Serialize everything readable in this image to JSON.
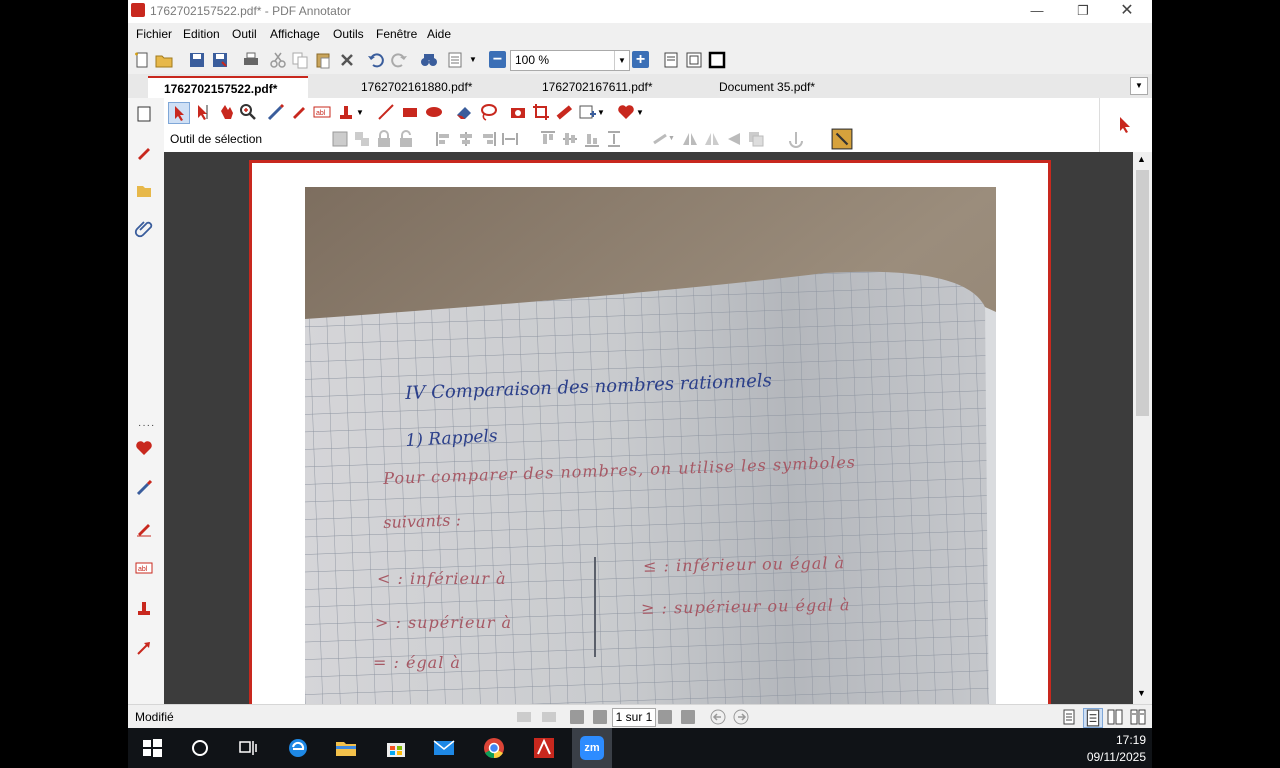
{
  "window": {
    "title": "1762702157522.pdf* - PDF Annotator"
  },
  "menu": [
    "Fichier",
    "Edition",
    "Outil",
    "Affichage",
    "Outils",
    "Fenêtre",
    "Aide"
  ],
  "toolbar": {
    "zoom_value": "100 %"
  },
  "tabs": [
    {
      "label": "1762702157522.pdf*",
      "active": true
    },
    {
      "label": "1762702161880.pdf*",
      "active": false
    },
    {
      "label": "1762702167611.pdf*",
      "active": false
    },
    {
      "label": "Document 35.pdf*",
      "active": false
    }
  ],
  "annotation_toolbar": {
    "current_tool": "Outil de sélection"
  },
  "document": {
    "notebook_lines": [
      "IV  Comparaison des nombres rationnels",
      "1) Rappels",
      "Pour comparer des nombres, on utilise les symboles",
      "suivants :",
      "< : inférieur à",
      "> : supérieur à",
      "= : égal à",
      "≤ : inférieur ou égal à",
      "≥ : supérieur ou égal à"
    ]
  },
  "statusbar": {
    "status": "Modifié",
    "page_indicator": "1 sur 1"
  },
  "taskbar": {
    "time": "17:19",
    "date": "09/11/2025",
    "zoom_app_label": "zm"
  },
  "colors": {
    "accent": "#c8281e",
    "ink_blue": "#2b3f8a",
    "ink_red": "#b0404a"
  }
}
